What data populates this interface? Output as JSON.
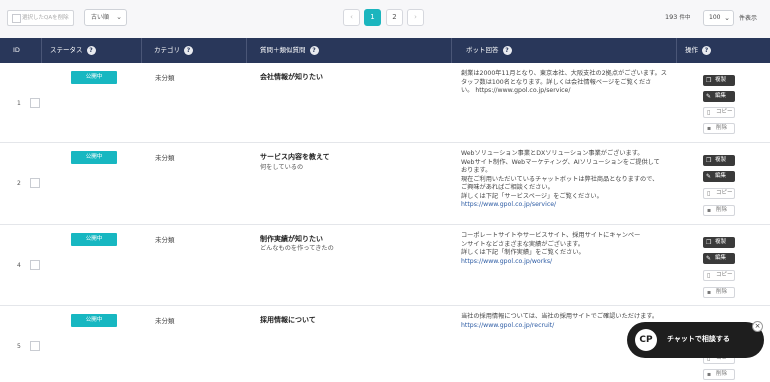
{
  "toolbar": {
    "delete_selected": "選択したQAを削除",
    "sort_value": "古い順",
    "pages": [
      "1",
      "2"
    ],
    "prev": "‹",
    "next": "›",
    "count": "193",
    "count_unit": "件中",
    "per_page": "100",
    "display": "件表示"
  },
  "table": {
    "headers": {
      "id": "ID",
      "status": "ステータス",
      "category": "カテゴリ",
      "question": "質問＋類似質問",
      "answer": "ボット回答",
      "actions": "操作"
    },
    "help_icon": "?",
    "rows": [
      {
        "id": "1",
        "status": "公開中",
        "category": "未分類",
        "question": "会社情報が知りたい",
        "similar": "",
        "answer": [
          "創業は2000年11月となり、東京本社、大阪支社の2拠点がございます。ス",
          "タッフ数は100名となります。詳しくは会社情報ページをご覧くださ",
          "い。 https://www.gpol.co.jp/service/"
        ],
        "link": ""
      },
      {
        "id": "2",
        "status": "公開中",
        "category": "未分類",
        "question": "サービス内容を教えて",
        "similar": "何をしているの",
        "answer": [
          "Webソリューション事業とDXソリューション事業がございます。",
          "Webサイト制作、Webマーケティング、AIソリューションをご提供して",
          "おります。",
          "現在ご利用いただいているチャットボットは弊社商品となりますので、",
          "ご興味があればご相談ください。",
          "詳しくは下記「サービスページ」をご覧ください。"
        ],
        "link": "https://www.gpol.co.jp/service/"
      },
      {
        "id": "4",
        "status": "公開中",
        "category": "未分類",
        "question": "制作実績が知りたい",
        "similar": "どんなものを作ってきたの",
        "answer": [
          "コーポレートサイトやサービスサイト、採用サイトにキャンペー",
          "ンサイトなどさまざまな実績がございます。",
          "詳しくは下記「制作実績」をご覧ください。"
        ],
        "link": "https://www.gpol.co.jp/works/"
      },
      {
        "id": "5",
        "status": "公開中",
        "category": "未分類",
        "question": "採用情報について",
        "similar": "",
        "answer": [
          "当社の採用情報については、当社の採用サイトでご確認いただけます。"
        ],
        "link": "https://www.gpol.co.jp/recruit/"
      }
    ],
    "actions": {
      "copy_dup": "複製",
      "edit": "編集",
      "copy": "コピー",
      "delete": "削除"
    }
  },
  "chat": {
    "label": "チャットで相談する",
    "logo": "CP",
    "close": "×"
  },
  "colors": {
    "header_bg": "#29375a",
    "accent": "#1bb5be",
    "chat_bg": "#1e1e1e"
  },
  "icons": [
    "duplicate-icon",
    "pencil-icon",
    "document-icon",
    "trash-icon",
    "question-icon",
    "chevron-down-icon"
  ]
}
